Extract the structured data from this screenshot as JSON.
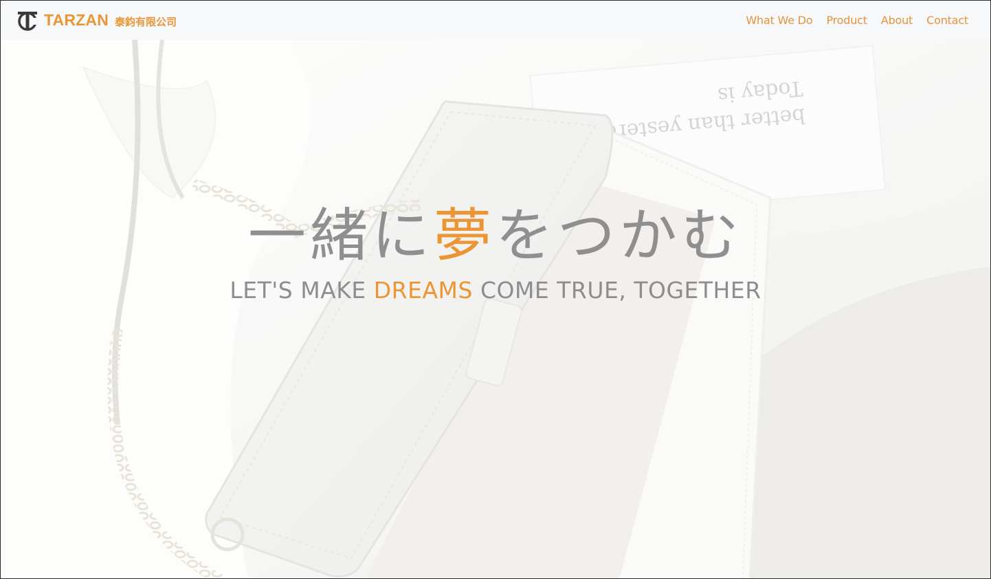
{
  "brand": {
    "name": "TARZAN",
    "name_cn": "泰鈞有限公司",
    "logo_icon": "tc-monogram-logo"
  },
  "nav": {
    "items": [
      {
        "label": "What We Do"
      },
      {
        "label": "Product"
      },
      {
        "label": "About"
      },
      {
        "label": "Contact"
      }
    ]
  },
  "hero": {
    "title_before": "一緒に",
    "title_accent": "夢",
    "title_after": "をつかむ",
    "subtitle_before": "LET'S MAKE ",
    "subtitle_accent": "DREAMS",
    "subtitle_after": " COME TRUE, TOGETHER",
    "note_line1": "better than yesterday.",
    "note_line2": "Today is"
  },
  "colors": {
    "accent": "#ec9535",
    "text_gray": "#8f8f8f",
    "navbar_bg": "#f7f8fa"
  }
}
